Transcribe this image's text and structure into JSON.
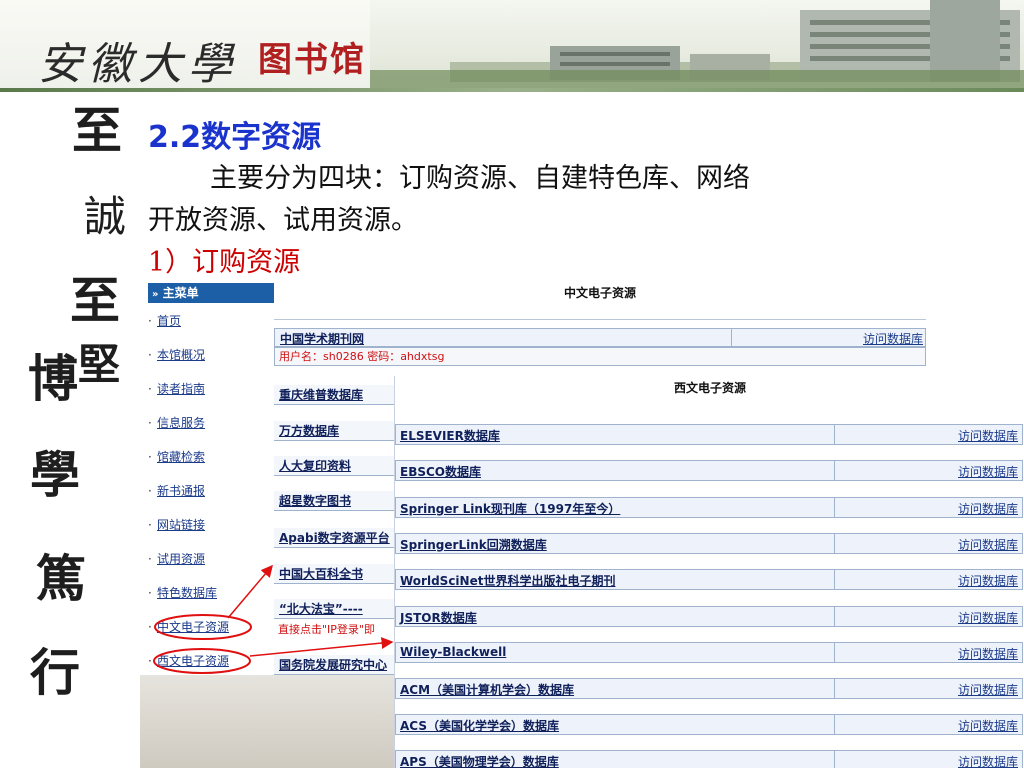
{
  "banner": {
    "university": "安徽大學",
    "library": "图书馆"
  },
  "motto": [
    "至",
    "誠",
    "至",
    "博",
    "學",
    "篤",
    "行"
  ],
  "motto_extra": "堅",
  "slide": {
    "title": "2.2数字资源",
    "intro_line1": "主要分为四块：订购资源、自建特色库、网络",
    "intro_line2": "开放资源、试用资源。",
    "subtitle": "1）订购资源"
  },
  "menu": {
    "header": "主菜单",
    "header_icon": "double-arrow-icon",
    "items": [
      "首页",
      "本馆概况",
      "读者指南",
      "信息服务",
      "馆藏检索",
      "新书通报",
      "网站链接",
      "试用资源",
      "特色数据库",
      "中文电子资源",
      "西文电子资源"
    ]
  },
  "cn_panel": {
    "title": "中文电子资源",
    "rows": [
      {
        "name": "中国学术期刊网",
        "visit": "访问数据库"
      }
    ],
    "credentials": "用户名：sh0286 密码：ahdxtsg",
    "partial_rows": [
      "重庆维普数据库",
      "万方数据库",
      "人大复印资料",
      "超星数字图书",
      "Apabi数字资源平台",
      "中国大百科全书",
      "“北大法宝”----",
      "国务院发展研究中心"
    ],
    "partial_note": "直接点击\"IP登录\"即"
  },
  "wx_panel": {
    "title": "西文电子资源",
    "rows": [
      {
        "name": "ELSEVIER数据库",
        "visit": "访问数据库"
      },
      {
        "name": "EBSCO数据库",
        "visit": "访问数据库"
      },
      {
        "name": "Springer Link现刊库（1997年至今）",
        "visit": "访问数据库"
      },
      {
        "name": "SpringerLink回溯数据库",
        "visit": "访问数据库"
      },
      {
        "name": "WorldSciNet世界科学出版社电子期刊",
        "visit": "访问数据库"
      },
      {
        "name": "JSTOR数据库",
        "visit": "访问数据库"
      },
      {
        "name": "Wiley-Blackwell",
        "visit": "访问数据库"
      },
      {
        "name": "ACM（美国计算机学会）数据库",
        "visit": "访问数据库"
      },
      {
        "name": "ACS（美国化学学会）数据库",
        "visit": "访问数据库"
      },
      {
        "name": "APS（美国物理学会）数据库",
        "visit": "访问数据库"
      }
    ]
  },
  "colors": {
    "title_blue": "#1a33cc",
    "subtitle_red": "#cc0000",
    "menu_header": "#1d5fa6",
    "annotation_red": "#e01010"
  }
}
